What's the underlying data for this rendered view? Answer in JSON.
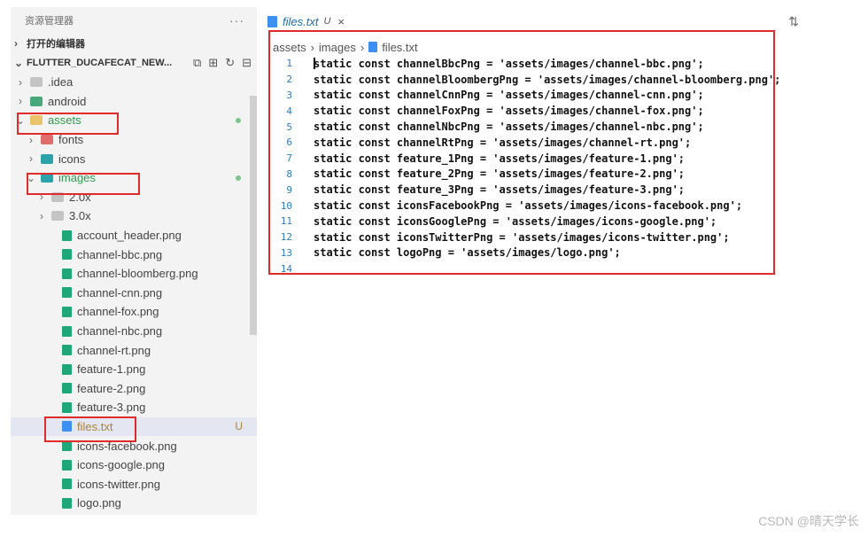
{
  "sidebar": {
    "title": "资源管理器",
    "more": "···",
    "open_editors": "打开的编辑器",
    "project": "FLUTTER_DUCAFECAT_NEW...",
    "tools": [
      "⧉",
      "⊞",
      "↻",
      "⊟"
    ],
    "tree": [
      {
        "label": ".idea",
        "chev": "›",
        "icon": "folder",
        "indent": 1
      },
      {
        "label": "android",
        "chev": "›",
        "icon": "folder-g",
        "indent": 1
      },
      {
        "label": "assets",
        "chev": "⌄",
        "icon": "folder-y",
        "indent": 1,
        "dot": true,
        "green": true,
        "boxed": true
      },
      {
        "label": "fonts",
        "chev": "›",
        "icon": "folder-r",
        "indent": 2
      },
      {
        "label": "icons",
        "chev": "›",
        "icon": "folder-t",
        "indent": 2
      },
      {
        "label": "images",
        "chev": "⌄",
        "icon": "folder-t",
        "indent": 2,
        "dot": true,
        "green": true,
        "boxed": true
      },
      {
        "label": "2.0x",
        "chev": "›",
        "icon": "folder",
        "indent": 3
      },
      {
        "label": "3.0x",
        "chev": "›",
        "icon": "folder",
        "indent": 3
      },
      {
        "label": "account_header.png",
        "icon": "img",
        "indent": 4
      },
      {
        "label": "channel-bbc.png",
        "icon": "img",
        "indent": 4
      },
      {
        "label": "channel-bloomberg.png",
        "icon": "img",
        "indent": 4
      },
      {
        "label": "channel-cnn.png",
        "icon": "img",
        "indent": 4
      },
      {
        "label": "channel-fox.png",
        "icon": "img",
        "indent": 4
      },
      {
        "label": "channel-nbc.png",
        "icon": "img",
        "indent": 4
      },
      {
        "label": "channel-rt.png",
        "icon": "img",
        "indent": 4
      },
      {
        "label": "feature-1.png",
        "icon": "img",
        "indent": 4
      },
      {
        "label": "feature-2.png",
        "icon": "img",
        "indent": 4
      },
      {
        "label": "feature-3.png",
        "icon": "img",
        "indent": 4
      },
      {
        "label": "files.txt",
        "icon": "txt",
        "indent": 4,
        "badge": "U",
        "selected": true,
        "gold": true,
        "boxed": true
      },
      {
        "label": "icons-facebook.png",
        "icon": "img",
        "indent": 4
      },
      {
        "label": "icons-google.png",
        "icon": "img",
        "indent": 4
      },
      {
        "label": "icons-twitter.png",
        "icon": "img",
        "indent": 4
      },
      {
        "label": "logo.png",
        "icon": "img",
        "indent": 4
      }
    ]
  },
  "editor": {
    "tab_label": "files.txt",
    "tab_mod": "U",
    "tab_close": "×",
    "tab_tool": "⇅",
    "breadcrumb": [
      "assets",
      "images",
      "files.txt"
    ],
    "lines": [
      "static const channelBbcPng = 'assets/images/channel-bbc.png';",
      "static const channelBloombergPng = 'assets/images/channel-bloomberg.png';",
      "static const channelCnnPng = 'assets/images/channel-cnn.png';",
      "static const channelFoxPng = 'assets/images/channel-fox.png';",
      "static const channelNbcPng = 'assets/images/channel-nbc.png';",
      "static const channelRtPng = 'assets/images/channel-rt.png';",
      "static const feature_1Png = 'assets/images/feature-1.png';",
      "static const feature_2Png = 'assets/images/feature-2.png';",
      "static const feature_3Png = 'assets/images/feature-3.png';",
      "static const iconsFacebookPng = 'assets/images/icons-facebook.png';",
      "static const iconsGooglePng = 'assets/images/icons-google.png';",
      "static const iconsTwitterPng = 'assets/images/icons-twitter.png';",
      "static const logoPng = 'assets/images/logo.png';",
      ""
    ]
  },
  "watermark": "CSDN @晴天学长"
}
